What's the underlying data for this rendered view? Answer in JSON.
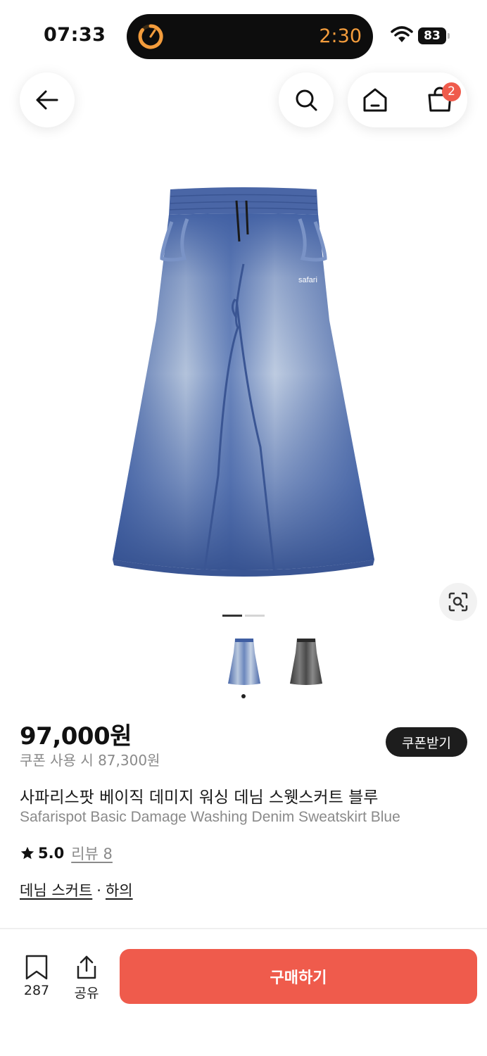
{
  "status_bar": {
    "time": "07:33",
    "timer": "2:30",
    "battery": "83"
  },
  "header": {
    "cart_badge": "2",
    "icons": [
      "back-arrow-icon",
      "search-icon",
      "home-icon",
      "shopping-bag-icon"
    ]
  },
  "gallery": {
    "total_slides": 2,
    "active_index": 0,
    "thumbnails": [
      "blue",
      "black"
    ]
  },
  "product": {
    "price": "97,000원",
    "coupon_price": "쿠폰 사용 시 87,300원",
    "coupon_button": "쿠폰받기",
    "title_ko": "사파리스팟 베이직 데미지 워싱 데님 스웻스커트 블루",
    "title_en": "Safarispot Basic Damage Washing Denim Sweatskirt Blue",
    "rating": "5.0",
    "review_label": "리뷰 8",
    "category_1": "데님 스커트",
    "separator": "·",
    "category_2": "하의",
    "brand_print": "safari"
  },
  "bottom_bar": {
    "save_count": "287",
    "share_label": "공유",
    "buy_label": "구매하기"
  },
  "colors": {
    "accent": "#ef5b4c",
    "dark_button": "#1d1d1d",
    "timer_orange": "#f39c3c"
  }
}
